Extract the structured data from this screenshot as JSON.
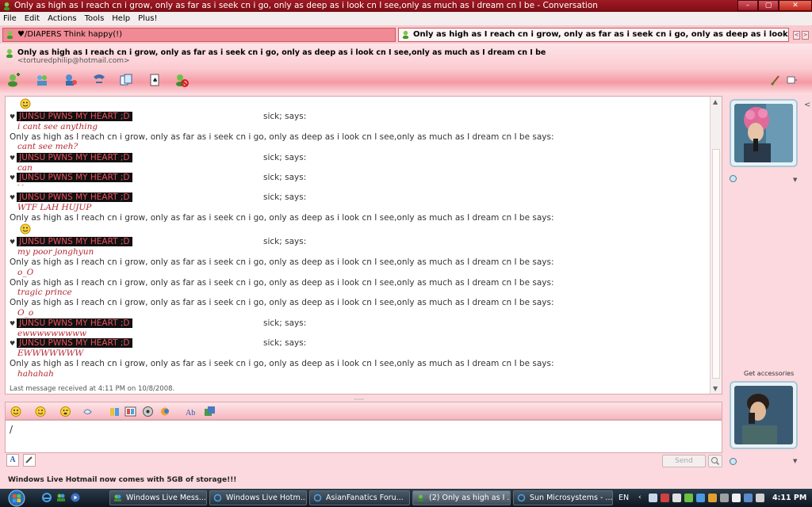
{
  "window": {
    "title": "Only as high as I reach cn i grow, only as far as i seek cn i go, only as deep as i look cn I see,only as much as I dream cn I be - Conversation",
    "controls": [
      "–",
      "▢",
      "✕"
    ]
  },
  "menu": [
    "File",
    "Edit",
    "Actions",
    "Tools",
    "Help",
    "Plus!"
  ],
  "tabs": [
    {
      "label": "♥/DIAPERS     Think happy(!)"
    },
    {
      "label": "Only as high as I reach cn i grow, only as far as i seek cn i go, only as deep as i look cn I see,only as mu..."
    }
  ],
  "contact": {
    "name": "Only as high as I reach cn i grow, only as far as i seek cn i go, only as deep as i look cn I see,only as much as I dream cn I be",
    "email": "<torturedphilip@hotmail.com>"
  },
  "toolbar_icons": [
    "invite-icon",
    "share-files-icon",
    "video-call-icon",
    "call-icon",
    "activities-icon",
    "games-icon",
    "block-icon"
  ],
  "history": {
    "me_nick": "JUNSU PWNS MY HEART ;D",
    "me_says": "sick; says:",
    "them_says": "Only as high as I reach cn i grow, only as far as i seek cn i go, only as deep as i look cn I see,only as much as I dream cn I be says:",
    "messages": [
      "i cant see anything",
      "cant see meh?",
      "can",
      "- -",
      "WTF LAH HUJUP",
      "my poor jonghyun",
      "o_O",
      "tragic prince",
      "O_o",
      "ewwwwwwwww",
      "EWWWWWWW",
      "hahahah"
    ],
    "footnote": "Last message received at 4:11 PM on 10/8/2008."
  },
  "compose": {
    "send_label": "Send",
    "caret": "/"
  },
  "status_text": "Windows Live Hotmail now comes with 5GB of storage!!!",
  "sidebar": {
    "accessories": "Get accessories"
  },
  "taskbar": {
    "buttons": [
      "Windows Live Mess...",
      "Windows Live Hotm...",
      "AsianFanatics Foru...",
      "(2) Only as high as I ...",
      "Sun Microsystems - ..."
    ],
    "lang": "EN",
    "time": "4:11 PM"
  },
  "colors": {
    "accent": "#f59aa4",
    "nick_bg": "#111111",
    "nick_text": "#e8525e",
    "message_text": "#b3262f"
  }
}
